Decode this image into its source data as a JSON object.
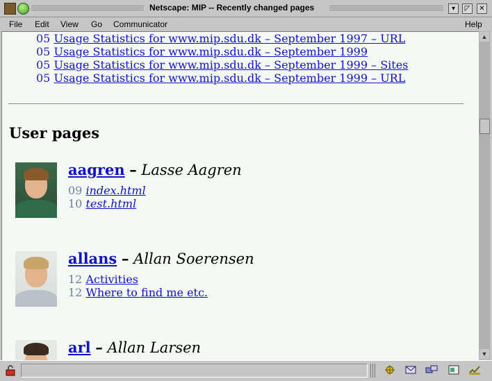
{
  "window": {
    "title": "Netscape: MIP -- Recently changed pages"
  },
  "menubar": {
    "items": [
      "File",
      "Edit",
      "View",
      "Go",
      "Communicator"
    ],
    "help": "Help"
  },
  "stats": [
    {
      "num": "05",
      "label": "Usage Statistics for www.mip.sdu.dk – September 1997 – URL"
    },
    {
      "num": "05",
      "label": "Usage Statistics for www.mip.sdu.dk – September 1999"
    },
    {
      "num": "05",
      "label": "Usage Statistics for www.mip.sdu.dk – September 1999 – Sites"
    },
    {
      "num": "05",
      "label": "Usage Statistics for www.mip.sdu.dk – September 1999 – URL"
    }
  ],
  "user_section": {
    "title": "User pages"
  },
  "users": [
    {
      "login": "aagren",
      "dash": "–",
      "fullname": "Lasse Aagren",
      "files": [
        {
          "num": "09",
          "label": "index.html"
        },
        {
          "num": "10",
          "label": "test.html"
        }
      ]
    },
    {
      "login": "allans",
      "dash": "–",
      "fullname": "Allan Soerensen",
      "files": [
        {
          "num": "12",
          "label": "Activities"
        },
        {
          "num": "12",
          "label": "Where to find me etc."
        }
      ]
    },
    {
      "login": "arl",
      "dash": "–",
      "fullname": "Allan Larsen",
      "files": []
    }
  ],
  "icons": {
    "titlebar_left": [
      "netscape-window-icon",
      "green-status-icon"
    ],
    "titlebar_right": [
      "minimize-icon",
      "maximize-icon",
      "close-icon"
    ],
    "status": [
      "lock-icon",
      "navigator-icon",
      "mail-icon",
      "discussion-icon",
      "composer-icon",
      "security-icon"
    ]
  },
  "colors": {
    "link": "#1010c8",
    "page_bg": "#f4f9f4",
    "chrome": "#c6c6c6"
  }
}
